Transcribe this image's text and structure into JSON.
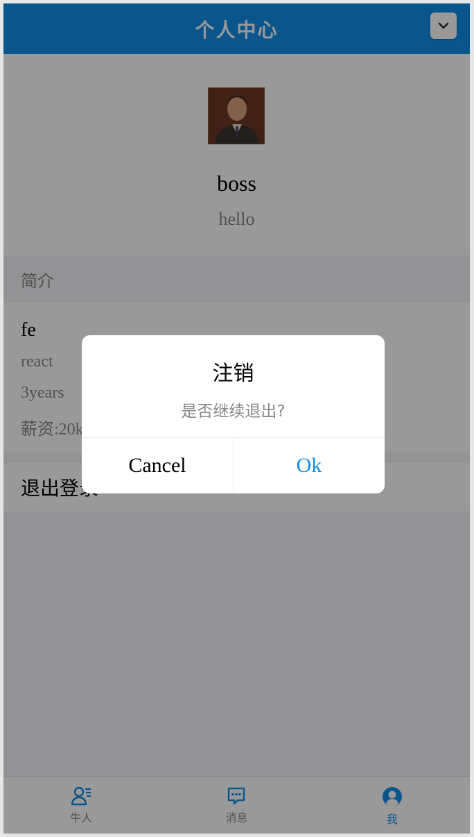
{
  "header": {
    "title": "个人中心",
    "dropdown_icon": "chevron-down-icon"
  },
  "profile": {
    "name": "boss",
    "subtitle": "hello"
  },
  "intro": {
    "section_label": "简介",
    "title": "fe",
    "lines": [
      "react",
      "3years",
      "薪资:20k"
    ]
  },
  "logout": {
    "label": "退出登录"
  },
  "tabbar": {
    "items": [
      {
        "label": "牛人",
        "icon": "user-list-icon",
        "active": false
      },
      {
        "label": "消息",
        "icon": "message-icon",
        "active": false
      },
      {
        "label": "我",
        "icon": "user-circle-icon",
        "active": true
      }
    ]
  },
  "modal": {
    "title": "注销",
    "message": "是否继续退出?",
    "cancel_label": "Cancel",
    "ok_label": "Ok"
  },
  "colors": {
    "primary": "#108ee9",
    "mask": "rgba(0,0,0,0.4)"
  }
}
